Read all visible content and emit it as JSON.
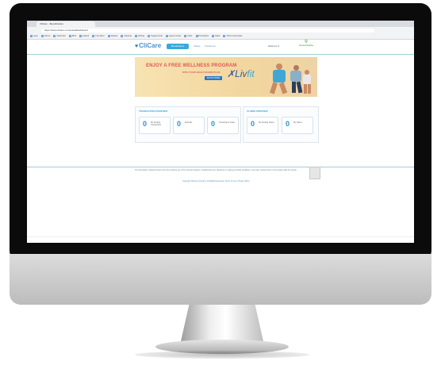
{
  "browser": {
    "tab_title": "CliCare - Beneficiaries",
    "url": "https://www.clicare.com/portal/dashboard",
    "bookmarks": [
      "Apps",
      "Nexus",
      "Starbucks",
      "Brief",
      "Eoland",
      "Free Beer",
      "Flipkart",
      "Cleartrip",
      "WeSay",
      "PageCentral",
      "Guest Center",
      "Flickr",
      "PhotoSites",
      "Slack",
      "Other bookmarks"
    ]
  },
  "site": {
    "logo": "CliCare",
    "nav": {
      "primary": "Beneficiaries",
      "links": [
        "Claims",
        "Contact Us"
      ]
    },
    "welcome": "Welcome ▾",
    "badge": "Secured Website"
  },
  "banner": {
    "title": "ENJOY A FREE WELLNESS PROGRAM",
    "subtitle": "WITH YOUR HEALTHCARE PLAN",
    "button": "KNOW MORE",
    "brand_prefix": "Liv",
    "brand_suffix": "fit"
  },
  "transaction_overview": {
    "title": "TRANSACTION OVERVIEW",
    "cards": [
      {
        "value": "0",
        "label": "My Pending Transactions"
      },
      {
        "value": "0",
        "label": "Referrals"
      },
      {
        "value": "0",
        "label": "Transactions Today"
      }
    ]
  },
  "claims_overview": {
    "title": "CLAIMS OVERVIEW",
    "cards": [
      {
        "value": "0",
        "label": "My Pending Claims"
      },
      {
        "value": "0",
        "label": "My Claims"
      }
    ]
  },
  "footer": {
    "disclaimer": "The information contained herein is for the exclusive use of the intended recipient. Unauthorised use, disclosure or copying is strictly prohibited. If you have received this in error please notify the sender.",
    "copyright": "Copyright CliCare Company. All Rights Reserved | Terms of Use | Privacy Policy"
  },
  "colors": {
    "accent": "#39a9d8",
    "brand": "#4a90c8",
    "banner_text": "#e05a5a"
  }
}
